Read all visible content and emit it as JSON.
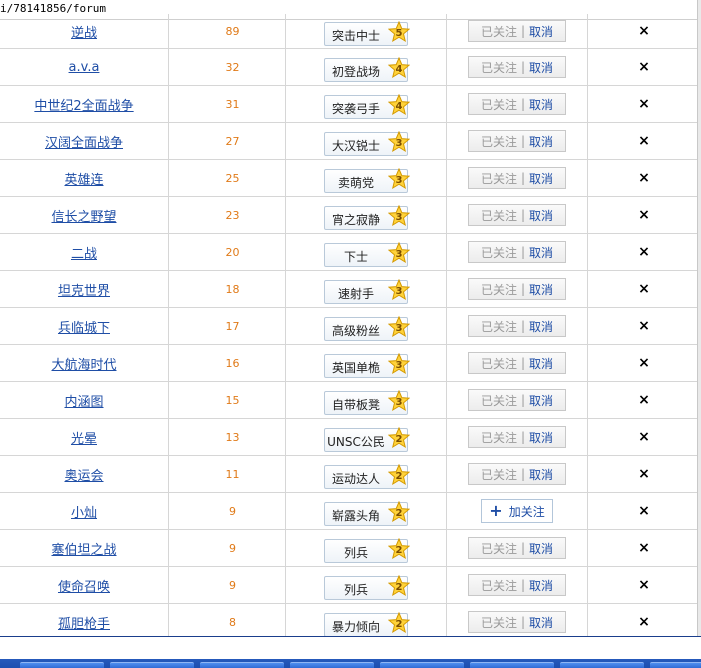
{
  "browser": {
    "url_text": "i/78141856/forum"
  },
  "forum_table": {
    "followed_label": "已关注",
    "separator": "|",
    "cancel_label": "取消",
    "add_follow_label": "加关注",
    "delete_symbol": "×",
    "rows": [
      {
        "name": "逆战",
        "exp": "89",
        "level_name": "突击中士",
        "level": "5",
        "status": "followed"
      },
      {
        "name": "a.v.a",
        "exp": "32",
        "level_name": "初登战场",
        "level": "4",
        "status": "followed"
      },
      {
        "name": "中世纪2全面战争",
        "exp": "31",
        "level_name": "突袭弓手",
        "level": "4",
        "status": "followed"
      },
      {
        "name": "汉阔全面战争",
        "exp": "27",
        "level_name": "大汉锐士",
        "level": "3",
        "status": "followed"
      },
      {
        "name": "英雄连",
        "exp": "25",
        "level_name": "卖萌党",
        "level": "3",
        "status": "followed"
      },
      {
        "name": "信长之野望",
        "exp": "23",
        "level_name": "宵之寂静",
        "level": "3",
        "status": "followed"
      },
      {
        "name": "二战",
        "exp": "20",
        "level_name": "下士",
        "level": "3",
        "status": "followed"
      },
      {
        "name": "坦克世界",
        "exp": "18",
        "level_name": "速射手",
        "level": "3",
        "status": "followed"
      },
      {
        "name": "兵临城下",
        "exp": "17",
        "level_name": "高级粉丝",
        "level": "3",
        "status": "followed"
      },
      {
        "name": "大航海时代",
        "exp": "16",
        "level_name": "英国单桅",
        "level": "3",
        "status": "followed"
      },
      {
        "name": "内涵图",
        "exp": "15",
        "level_name": "自带板凳",
        "level": "3",
        "status": "followed"
      },
      {
        "name": "光晕",
        "exp": "13",
        "level_name": "UNSC公民",
        "level": "2",
        "status": "followed"
      },
      {
        "name": "奥运会",
        "exp": "11",
        "level_name": "运动达人",
        "level": "2",
        "status": "followed"
      },
      {
        "name": "小灿",
        "exp": "9",
        "level_name": "崭露头角",
        "level": "2",
        "status": "not_followed"
      },
      {
        "name": "塞伯坦之战",
        "exp": "9",
        "level_name": "列兵",
        "level": "2",
        "status": "followed"
      },
      {
        "name": "使命召唤",
        "exp": "9",
        "level_name": "列兵",
        "level": "2",
        "status": "followed"
      },
      {
        "name": "孤胆枪手",
        "exp": "8",
        "level_name": "暴力倾向",
        "level": "2",
        "status": "followed"
      }
    ]
  },
  "colors": {
    "link": "#1f4ea6",
    "exp_number": "#e07a18",
    "taskbar": "#245edb"
  }
}
